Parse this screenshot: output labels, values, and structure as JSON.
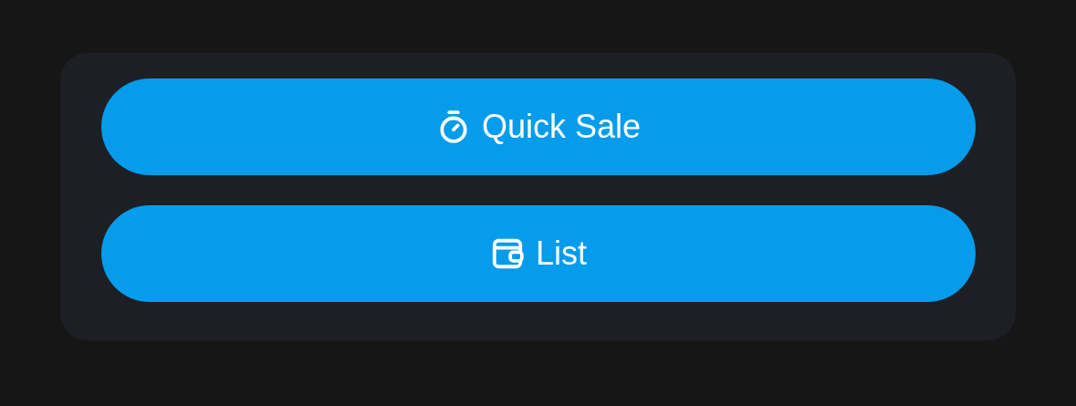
{
  "buttons": [
    {
      "label": "Quick Sale",
      "kind": "stopwatch"
    },
    {
      "label": "List",
      "kind": "wallet"
    }
  ]
}
